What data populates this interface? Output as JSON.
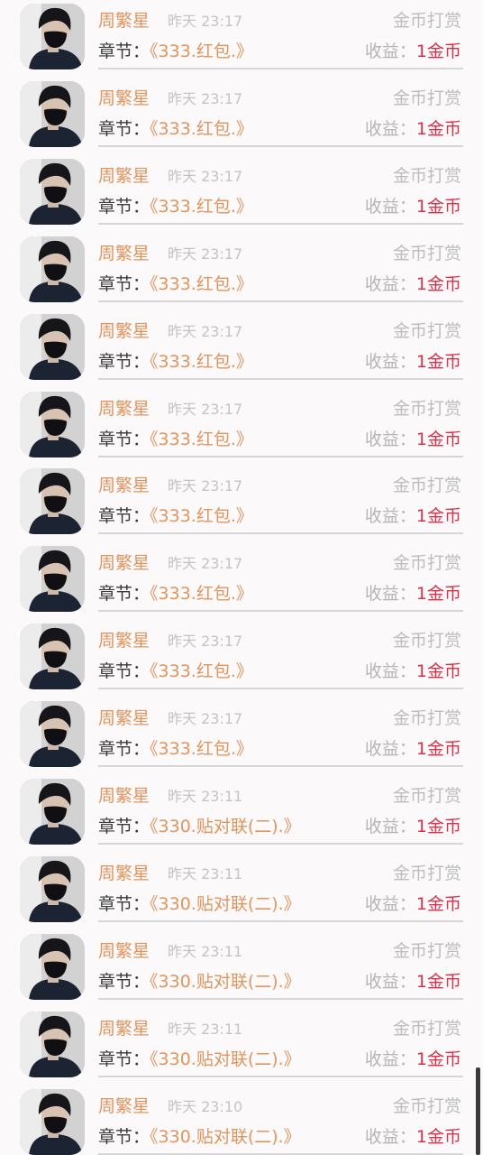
{
  "rewards": [
    {
      "name": "周繁星",
      "time": "昨天 23:17",
      "type": "金币打赏",
      "chapter_label": "章节：",
      "chapter": "《333.红包.》",
      "income_label": "收益：",
      "income": "1金币"
    },
    {
      "name": "周繁星",
      "time": "昨天 23:17",
      "type": "金币打赏",
      "chapter_label": "章节：",
      "chapter": "《333.红包.》",
      "income_label": "收益：",
      "income": "1金币"
    },
    {
      "name": "周繁星",
      "time": "昨天 23:17",
      "type": "金币打赏",
      "chapter_label": "章节：",
      "chapter": "《333.红包.》",
      "income_label": "收益：",
      "income": "1金币"
    },
    {
      "name": "周繁星",
      "time": "昨天 23:17",
      "type": "金币打赏",
      "chapter_label": "章节：",
      "chapter": "《333.红包.》",
      "income_label": "收益：",
      "income": "1金币"
    },
    {
      "name": "周繁星",
      "time": "昨天 23:17",
      "type": "金币打赏",
      "chapter_label": "章节：",
      "chapter": "《333.红包.》",
      "income_label": "收益：",
      "income": "1金币"
    },
    {
      "name": "周繁星",
      "time": "昨天 23:17",
      "type": "金币打赏",
      "chapter_label": "章节：",
      "chapter": "《333.红包.》",
      "income_label": "收益：",
      "income": "1金币"
    },
    {
      "name": "周繁星",
      "time": "昨天 23:17",
      "type": "金币打赏",
      "chapter_label": "章节：",
      "chapter": "《333.红包.》",
      "income_label": "收益：",
      "income": "1金币"
    },
    {
      "name": "周繁星",
      "time": "昨天 23:17",
      "type": "金币打赏",
      "chapter_label": "章节：",
      "chapter": "《333.红包.》",
      "income_label": "收益：",
      "income": "1金币"
    },
    {
      "name": "周繁星",
      "time": "昨天 23:17",
      "type": "金币打赏",
      "chapter_label": "章节：",
      "chapter": "《333.红包.》",
      "income_label": "收益：",
      "income": "1金币"
    },
    {
      "name": "周繁星",
      "time": "昨天 23:17",
      "type": "金币打赏",
      "chapter_label": "章节：",
      "chapter": "《333.红包.》",
      "income_label": "收益：",
      "income": "1金币"
    },
    {
      "name": "周繁星",
      "time": "昨天 23:11",
      "type": "金币打赏",
      "chapter_label": "章节：",
      "chapter": "《330.贴对联(二).》",
      "income_label": "收益：",
      "income": "1金币"
    },
    {
      "name": "周繁星",
      "time": "昨天 23:11",
      "type": "金币打赏",
      "chapter_label": "章节：",
      "chapter": "《330.贴对联(二).》",
      "income_label": "收益：",
      "income": "1金币"
    },
    {
      "name": "周繁星",
      "time": "昨天 23:11",
      "type": "金币打赏",
      "chapter_label": "章节：",
      "chapter": "《330.贴对联(二).》",
      "income_label": "收益：",
      "income": "1金币"
    },
    {
      "name": "周繁星",
      "time": "昨天 23:11",
      "type": "金币打赏",
      "chapter_label": "章节：",
      "chapter": "《330.贴对联(二).》",
      "income_label": "收益：",
      "income": "1金币"
    },
    {
      "name": "周繁星",
      "time": "昨天 23:10",
      "type": "金币打赏",
      "chapter_label": "章节：",
      "chapter": "《330.贴对联(二).》",
      "income_label": "收益：",
      "income": "1金币"
    }
  ],
  "avatar_icon": "user-avatar-photo",
  "colors": {
    "accent": "#e0955f",
    "income": "#d8324b",
    "muted": "#bdbdbd",
    "background": "#fbf9f9"
  }
}
